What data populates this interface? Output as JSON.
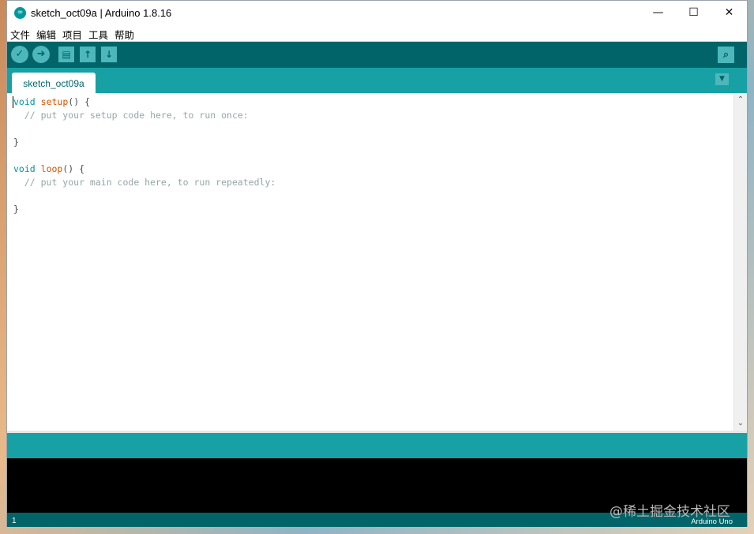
{
  "window": {
    "title": "sketch_oct09a | Arduino 1.8.16",
    "app_icon": "∞",
    "controls": {
      "minimize": "—",
      "maximize": "☐",
      "close": "✕"
    }
  },
  "menu": {
    "items": [
      "文件",
      "编辑",
      "项目",
      "工具",
      "帮助"
    ]
  },
  "toolbar": {
    "verify_icon": "✓",
    "upload_icon": "➜",
    "new_icon": "▤",
    "open_icon": "↑",
    "save_icon": "↓",
    "serial_monitor_icon": "⌕"
  },
  "tabs": {
    "active": "sketch_oct09a",
    "menu_icon": "▼"
  },
  "editor": {
    "lines": [
      {
        "kw": "void",
        "fn": "setup",
        "rest": "() {"
      },
      {
        "comment": "  // put your setup code here, to run once:"
      },
      {
        "text": ""
      },
      {
        "text": "}"
      },
      {
        "text": ""
      },
      {
        "kw": "void",
        "fn": "loop",
        "rest": "() {"
      },
      {
        "comment": "  // put your main code here, to run repeatedly:"
      },
      {
        "text": ""
      },
      {
        "text": "}"
      }
    ],
    "scroll_up": "⌃",
    "scroll_down": "⌄"
  },
  "status": {
    "line": "1",
    "board": "Arduino Uno"
  },
  "watermark": "@稀土掘金技术社区",
  "colors": {
    "toolbar": "#006468",
    "tabbar": "#17a1a5",
    "button": "#4db7bb",
    "keyword": "#00979c",
    "function": "#d35400",
    "comment": "#95a5a6",
    "console": "#000000"
  }
}
